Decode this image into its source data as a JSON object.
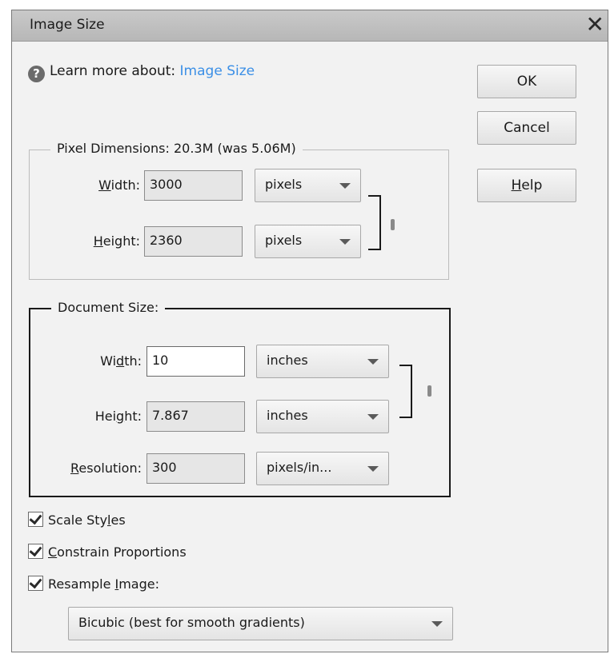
{
  "dialog": {
    "title": "Image Size",
    "help_prefix": "Learn more about:",
    "help_link": "Image Size"
  },
  "buttons": {
    "ok": "OK",
    "cancel": "Cancel",
    "help_first": "H",
    "help_rest": "elp"
  },
  "pixel_dimensions": {
    "title": "Pixel Dimensions:  20.3M (was 5.06M)",
    "width_label_ul": "W",
    "width_label_rest": "idth:",
    "width_value": "3000",
    "width_unit": "pixels",
    "height_label_ul": "H",
    "height_label_rest": "eight:",
    "height_value": "2360",
    "height_unit": "pixels"
  },
  "document_size": {
    "title": "Document Size:",
    "width_label_pre": "Wi",
    "width_label_ul": "d",
    "width_label_rest": "th:",
    "width_value": "10",
    "width_unit": "inches",
    "height_label_pre": "Hei",
    "height_label_ul": "g",
    "height_label_rest": "ht:",
    "height_value": "7.867",
    "height_unit": "inches",
    "resolution_label_ul": "R",
    "resolution_label_rest": "esolution:",
    "resolution_value": "300",
    "resolution_unit": "pixels/in..."
  },
  "options": {
    "scale_styles_pre": "Scale Sty",
    "scale_styles_ul": "l",
    "scale_styles_rest": "es",
    "scale_styles_checked": true,
    "constrain_ul": "C",
    "constrain_rest": "onstrain Proportions",
    "constrain_checked": true,
    "resample_pre": "Resample ",
    "resample_ul": "I",
    "resample_rest": "mage:",
    "resample_checked": true,
    "resample_method": "Bicubic (best for smooth gradients)"
  },
  "icons": {
    "help": "help-circle-icon",
    "close": "close-icon",
    "dropdown": "chevron-down-icon",
    "link": "chain-link-icon",
    "check": "checkmark-icon"
  }
}
